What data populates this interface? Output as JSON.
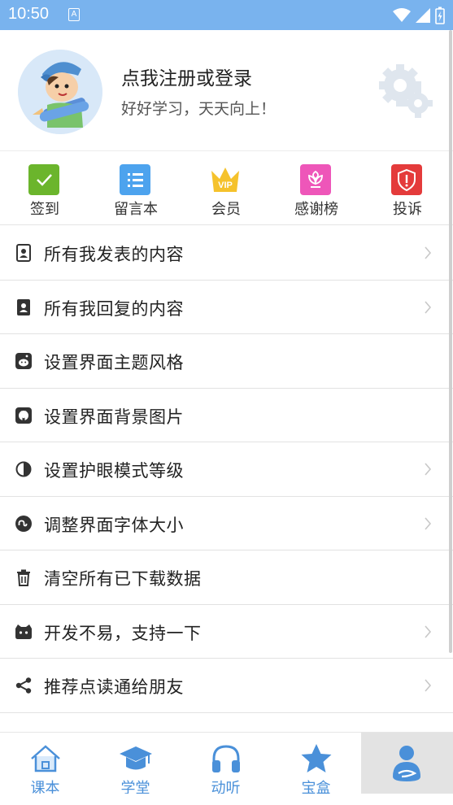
{
  "status_bar": {
    "time": "10:50",
    "notification_glyph": "A"
  },
  "profile": {
    "title": "点我注册或登录",
    "subtitle": "好好学习，天天向上！"
  },
  "quick_actions": [
    {
      "label": "签到",
      "icon": "checkmark-icon",
      "color": "#6bb52c"
    },
    {
      "label": "留言本",
      "icon": "list-icon",
      "color": "#4da3ee"
    },
    {
      "label": "会员",
      "icon": "vip-crown-icon",
      "color": "#f5c22c"
    },
    {
      "label": "感谢榜",
      "icon": "flower-icon",
      "color": "#ee56b9"
    },
    {
      "label": "投诉",
      "icon": "alert-shield-icon",
      "color": "#e43b3b"
    }
  ],
  "menu": [
    {
      "label": "所有我发表的内容",
      "icon": "contact-book-icon"
    },
    {
      "label": "所有我回复的内容",
      "icon": "contact-book-filled-icon"
    },
    {
      "label": "设置界面主题风格",
      "icon": "reddit-icon"
    },
    {
      "label": "设置界面背景图片",
      "icon": "github-icon"
    },
    {
      "label": "设置护眼模式等级",
      "icon": "contrast-icon"
    },
    {
      "label": "调整界面字体大小",
      "icon": "stumbleupon-icon"
    },
    {
      "label": "清空所有已下载数据",
      "icon": "trash-icon"
    },
    {
      "label": "开发不易，支持一下",
      "icon": "cat-icon"
    },
    {
      "label": "推荐点读通给朋友",
      "icon": "share-icon"
    }
  ],
  "bottom_nav": [
    {
      "label": "课本",
      "icon": "home-icon"
    },
    {
      "label": "学堂",
      "icon": "graduation-cap-icon"
    },
    {
      "label": "动听",
      "icon": "headphones-icon"
    },
    {
      "label": "宝盒",
      "icon": "star-icon"
    },
    {
      "label": "",
      "icon": "user-icon"
    }
  ],
  "colors": {
    "status_bar": "#79b3ee",
    "accent": "#4a90d9",
    "active_tab_bg": "#e3e3e3"
  }
}
